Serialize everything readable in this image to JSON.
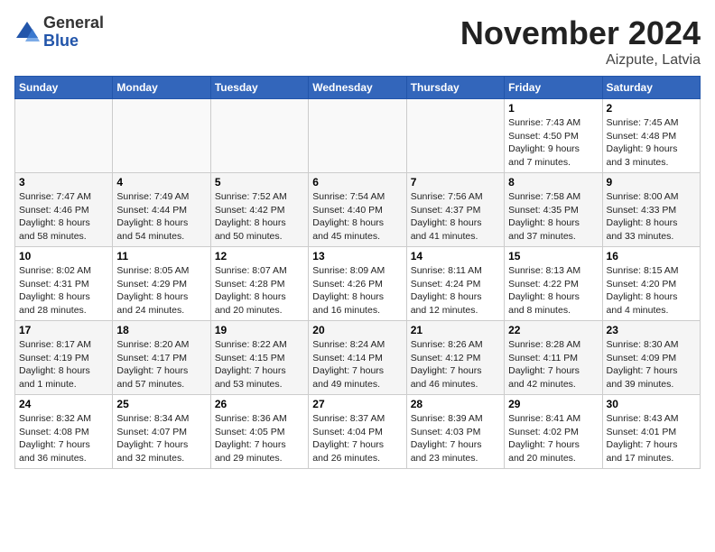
{
  "logo": {
    "line1": "General",
    "line2": "Blue"
  },
  "title": "November 2024",
  "location": "Aizpute, Latvia",
  "weekdays": [
    "Sunday",
    "Monday",
    "Tuesday",
    "Wednesday",
    "Thursday",
    "Friday",
    "Saturday"
  ],
  "weeks": [
    [
      {
        "day": "",
        "info": ""
      },
      {
        "day": "",
        "info": ""
      },
      {
        "day": "",
        "info": ""
      },
      {
        "day": "",
        "info": ""
      },
      {
        "day": "",
        "info": ""
      },
      {
        "day": "1",
        "info": "Sunrise: 7:43 AM\nSunset: 4:50 PM\nDaylight: 9 hours\nand 7 minutes."
      },
      {
        "day": "2",
        "info": "Sunrise: 7:45 AM\nSunset: 4:48 PM\nDaylight: 9 hours\nand 3 minutes."
      }
    ],
    [
      {
        "day": "3",
        "info": "Sunrise: 7:47 AM\nSunset: 4:46 PM\nDaylight: 8 hours\nand 58 minutes."
      },
      {
        "day": "4",
        "info": "Sunrise: 7:49 AM\nSunset: 4:44 PM\nDaylight: 8 hours\nand 54 minutes."
      },
      {
        "day": "5",
        "info": "Sunrise: 7:52 AM\nSunset: 4:42 PM\nDaylight: 8 hours\nand 50 minutes."
      },
      {
        "day": "6",
        "info": "Sunrise: 7:54 AM\nSunset: 4:40 PM\nDaylight: 8 hours\nand 45 minutes."
      },
      {
        "day": "7",
        "info": "Sunrise: 7:56 AM\nSunset: 4:37 PM\nDaylight: 8 hours\nand 41 minutes."
      },
      {
        "day": "8",
        "info": "Sunrise: 7:58 AM\nSunset: 4:35 PM\nDaylight: 8 hours\nand 37 minutes."
      },
      {
        "day": "9",
        "info": "Sunrise: 8:00 AM\nSunset: 4:33 PM\nDaylight: 8 hours\nand 33 minutes."
      }
    ],
    [
      {
        "day": "10",
        "info": "Sunrise: 8:02 AM\nSunset: 4:31 PM\nDaylight: 8 hours\nand 28 minutes."
      },
      {
        "day": "11",
        "info": "Sunrise: 8:05 AM\nSunset: 4:29 PM\nDaylight: 8 hours\nand 24 minutes."
      },
      {
        "day": "12",
        "info": "Sunrise: 8:07 AM\nSunset: 4:28 PM\nDaylight: 8 hours\nand 20 minutes."
      },
      {
        "day": "13",
        "info": "Sunrise: 8:09 AM\nSunset: 4:26 PM\nDaylight: 8 hours\nand 16 minutes."
      },
      {
        "day": "14",
        "info": "Sunrise: 8:11 AM\nSunset: 4:24 PM\nDaylight: 8 hours\nand 12 minutes."
      },
      {
        "day": "15",
        "info": "Sunrise: 8:13 AM\nSunset: 4:22 PM\nDaylight: 8 hours\nand 8 minutes."
      },
      {
        "day": "16",
        "info": "Sunrise: 8:15 AM\nSunset: 4:20 PM\nDaylight: 8 hours\nand 4 minutes."
      }
    ],
    [
      {
        "day": "17",
        "info": "Sunrise: 8:17 AM\nSunset: 4:19 PM\nDaylight: 8 hours\nand 1 minute."
      },
      {
        "day": "18",
        "info": "Sunrise: 8:20 AM\nSunset: 4:17 PM\nDaylight: 7 hours\nand 57 minutes."
      },
      {
        "day": "19",
        "info": "Sunrise: 8:22 AM\nSunset: 4:15 PM\nDaylight: 7 hours\nand 53 minutes."
      },
      {
        "day": "20",
        "info": "Sunrise: 8:24 AM\nSunset: 4:14 PM\nDaylight: 7 hours\nand 49 minutes."
      },
      {
        "day": "21",
        "info": "Sunrise: 8:26 AM\nSunset: 4:12 PM\nDaylight: 7 hours\nand 46 minutes."
      },
      {
        "day": "22",
        "info": "Sunrise: 8:28 AM\nSunset: 4:11 PM\nDaylight: 7 hours\nand 42 minutes."
      },
      {
        "day": "23",
        "info": "Sunrise: 8:30 AM\nSunset: 4:09 PM\nDaylight: 7 hours\nand 39 minutes."
      }
    ],
    [
      {
        "day": "24",
        "info": "Sunrise: 8:32 AM\nSunset: 4:08 PM\nDaylight: 7 hours\nand 36 minutes."
      },
      {
        "day": "25",
        "info": "Sunrise: 8:34 AM\nSunset: 4:07 PM\nDaylight: 7 hours\nand 32 minutes."
      },
      {
        "day": "26",
        "info": "Sunrise: 8:36 AM\nSunset: 4:05 PM\nDaylight: 7 hours\nand 29 minutes."
      },
      {
        "day": "27",
        "info": "Sunrise: 8:37 AM\nSunset: 4:04 PM\nDaylight: 7 hours\nand 26 minutes."
      },
      {
        "day": "28",
        "info": "Sunrise: 8:39 AM\nSunset: 4:03 PM\nDaylight: 7 hours\nand 23 minutes."
      },
      {
        "day": "29",
        "info": "Sunrise: 8:41 AM\nSunset: 4:02 PM\nDaylight: 7 hours\nand 20 minutes."
      },
      {
        "day": "30",
        "info": "Sunrise: 8:43 AM\nSunset: 4:01 PM\nDaylight: 7 hours\nand 17 minutes."
      }
    ]
  ]
}
